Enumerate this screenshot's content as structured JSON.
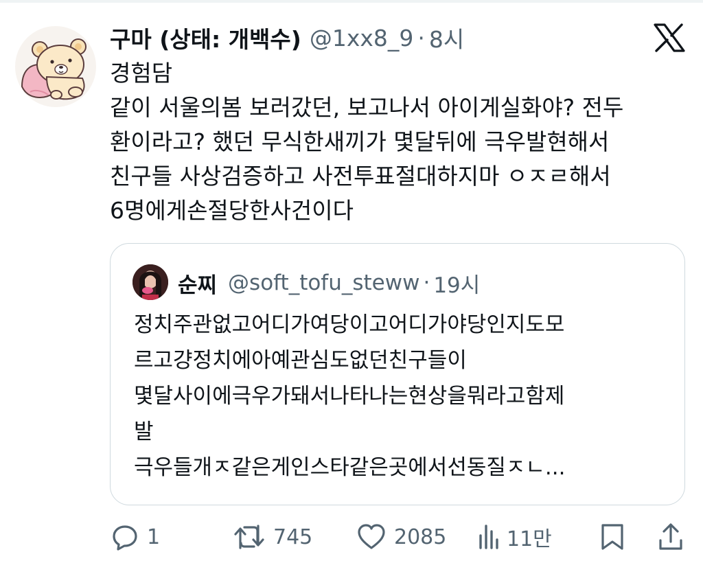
{
  "tweet": {
    "display_name": "구마 (상태: 개백수)",
    "handle": "@1xx8_9",
    "separator": "·",
    "time": "8시",
    "lines": [
      "경험담",
      "같이 서울의봄 보러갔던, 보고나서 아이게실화야? 전두",
      "환이라고? 했던 무식한새끼가 몇달뒤에 극우발현해서",
      "친구들 사상검증하고 사전투표절대하지마 ㅇㅈㄹ해서",
      "6명에게손절당한사건이다"
    ]
  },
  "quote": {
    "display_name": "순찌",
    "handle": "@soft_tofu_steww",
    "separator": "·",
    "time": "19시",
    "lines": [
      "정치주관없고어디가여당이고어디가야당인지도모",
      "르고걍정치에아예관심도없던친구들이",
      "몇달사이에극우가돼서나타나는현상을뭐라고함제",
      "발",
      "극우들개ㅈ같은게인스타같은곳에서선동질ㅈㄴ..."
    ]
  },
  "actions": {
    "reply_count": "1",
    "retweet_count": "745",
    "like_count": "2085",
    "view_count": "11만",
    "icons": [
      "reply-icon",
      "retweet-icon",
      "like-icon",
      "views-icon",
      "bookmark-icon",
      "share-icon"
    ]
  },
  "colors": {
    "text": "#0f1419",
    "secondary": "#536471",
    "border": "#cfd9de"
  }
}
